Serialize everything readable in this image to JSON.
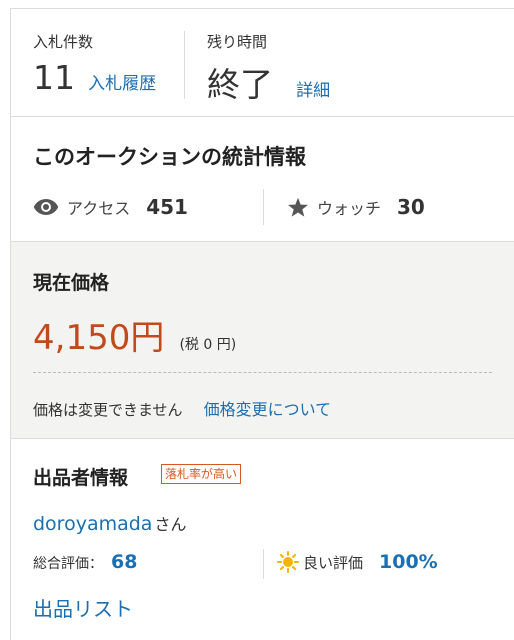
{
  "bids": {
    "label": "入札件数",
    "count": "11",
    "history_link": "入札履歴"
  },
  "time": {
    "label": "残り時間",
    "value": "終了",
    "detail_link": "詳細"
  },
  "stats": {
    "title": "このオークションの統計情報",
    "access_label": "アクセス",
    "access_value": "451",
    "watch_label": "ウォッチ",
    "watch_value": "30",
    "icons": [
      "eye-icon",
      "star-icon"
    ]
  },
  "price": {
    "title": "現在価格",
    "value": "4,150円",
    "tax": "(税 0 円)",
    "note": "価格は変更できません",
    "change_link": "価格変更について"
  },
  "seller": {
    "title": "出品者情報",
    "badge": "落札率が高い",
    "name": "doroyamada",
    "honorific": "さん",
    "total_rating_label": "総合評価：",
    "total_rating_value": "68",
    "good_rating_label": "良い評価",
    "good_rating_value": "100%",
    "list_link": "出品リスト"
  },
  "colors": {
    "link": "#1b6fb3",
    "price": "#c2491a",
    "badge": "#d9581b",
    "sun": "#f5b400"
  }
}
